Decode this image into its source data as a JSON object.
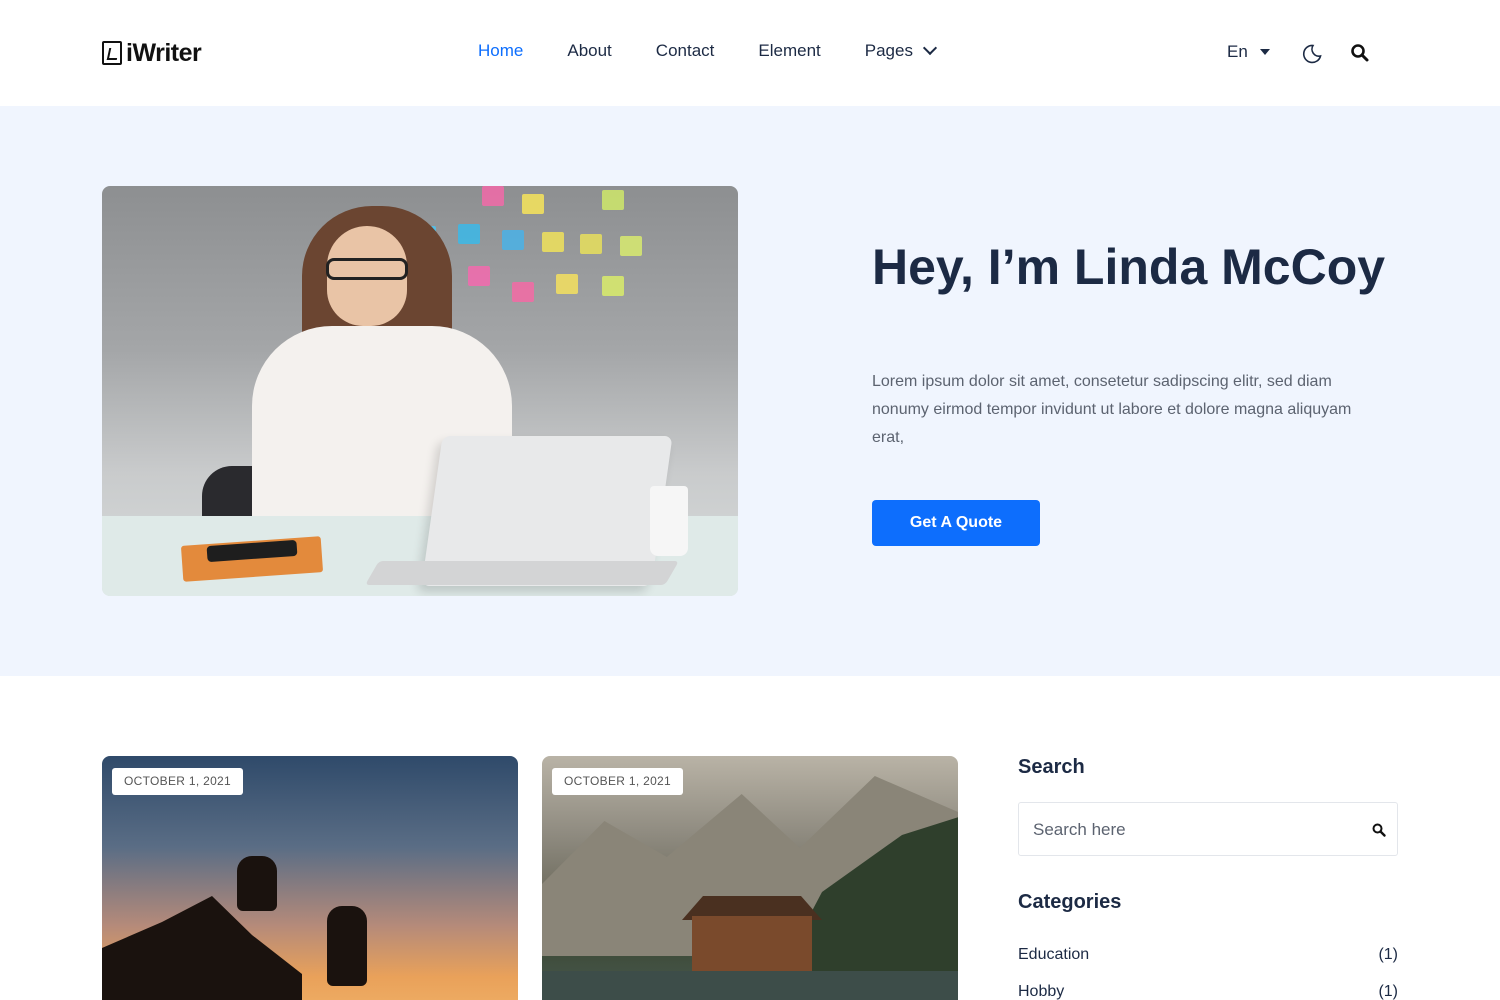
{
  "header": {
    "logo_text": "iWriter",
    "nav": [
      {
        "label": "Home",
        "active": true
      },
      {
        "label": "About"
      },
      {
        "label": "Contact"
      },
      {
        "label": "Element"
      },
      {
        "label": "Pages"
      }
    ],
    "language": "En",
    "icons": [
      "chevron-down-icon",
      "caret-down-icon",
      "moon-icon",
      "search-icon"
    ]
  },
  "hero": {
    "title": "Hey, I’m Linda McCoy",
    "text": "Lorem ipsum dolor sit amet, consetetur sadipscing elitr, sed diam nonumy eirmod tempor invidunt ut labore et dolore magna aliquyam erat,",
    "button_label": "Get A Quote"
  },
  "posts": [
    {
      "date": "OCTOBER 1, 2021"
    },
    {
      "date": "OCTOBER 1, 2021"
    }
  ],
  "sidebar": {
    "search_title": "Search",
    "search_placeholder": "Search here",
    "categories_title": "Categories",
    "categories": [
      {
        "name": "Education",
        "count": "(1)"
      },
      {
        "name": "Hobby",
        "count": "(1)"
      }
    ]
  },
  "colors": {
    "accent": "#0d6efd",
    "heading": "#1c2a44",
    "hero_bg": "#f0f5fe",
    "body_text": "#5c6370"
  }
}
